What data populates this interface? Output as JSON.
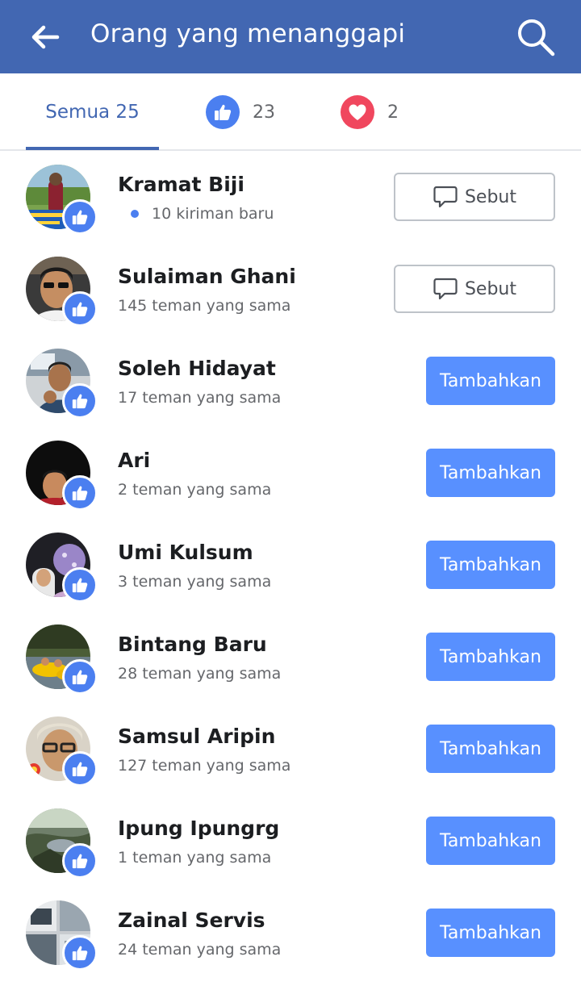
{
  "header": {
    "title": "Orang yang menanggapi",
    "back_icon": "arrow-left-icon",
    "search_icon": "search-icon",
    "background": "#4267b2"
  },
  "tabs": {
    "all_label": "Semua 25",
    "like_count": "23",
    "love_count": "2",
    "like_icon": "thumbs-up-icon",
    "love_icon": "heart-icon",
    "like_color": "#4b7ff0",
    "love_color": "#f0475e"
  },
  "people": [
    {
      "name": "Kramat Biji",
      "subtitle": "10 kiriman baru",
      "new_posts_dot": true,
      "action": "Sebut",
      "action_type": "mention"
    },
    {
      "name": "Sulaiman Ghani",
      "subtitle": "145 teman yang sama",
      "action": "Sebut",
      "action_type": "mention"
    },
    {
      "name": "Soleh Hidayat",
      "subtitle": "17 teman yang sama",
      "action": "Tambahkan",
      "action_type": "add"
    },
    {
      "name": "Ari",
      "subtitle": "2 teman yang sama",
      "action": "Tambahkan",
      "action_type": "add"
    },
    {
      "name": "Umi Kulsum",
      "subtitle": "3 teman yang sama",
      "action": "Tambahkan",
      "action_type": "add"
    },
    {
      "name": "Bintang Baru",
      "subtitle": "28 teman yang sama",
      "action": "Tambahkan",
      "action_type": "add"
    },
    {
      "name": "Samsul Aripin",
      "subtitle": "127 teman yang sama",
      "action": "Tambahkan",
      "action_type": "add"
    },
    {
      "name": "Ipung Ipungrg",
      "subtitle": "1 teman yang sama",
      "action": "Tambahkan",
      "action_type": "add"
    },
    {
      "name": "Zainal Servis",
      "subtitle": "24 teman yang sama",
      "action": "Tambahkan",
      "action_type": "add"
    }
  ]
}
